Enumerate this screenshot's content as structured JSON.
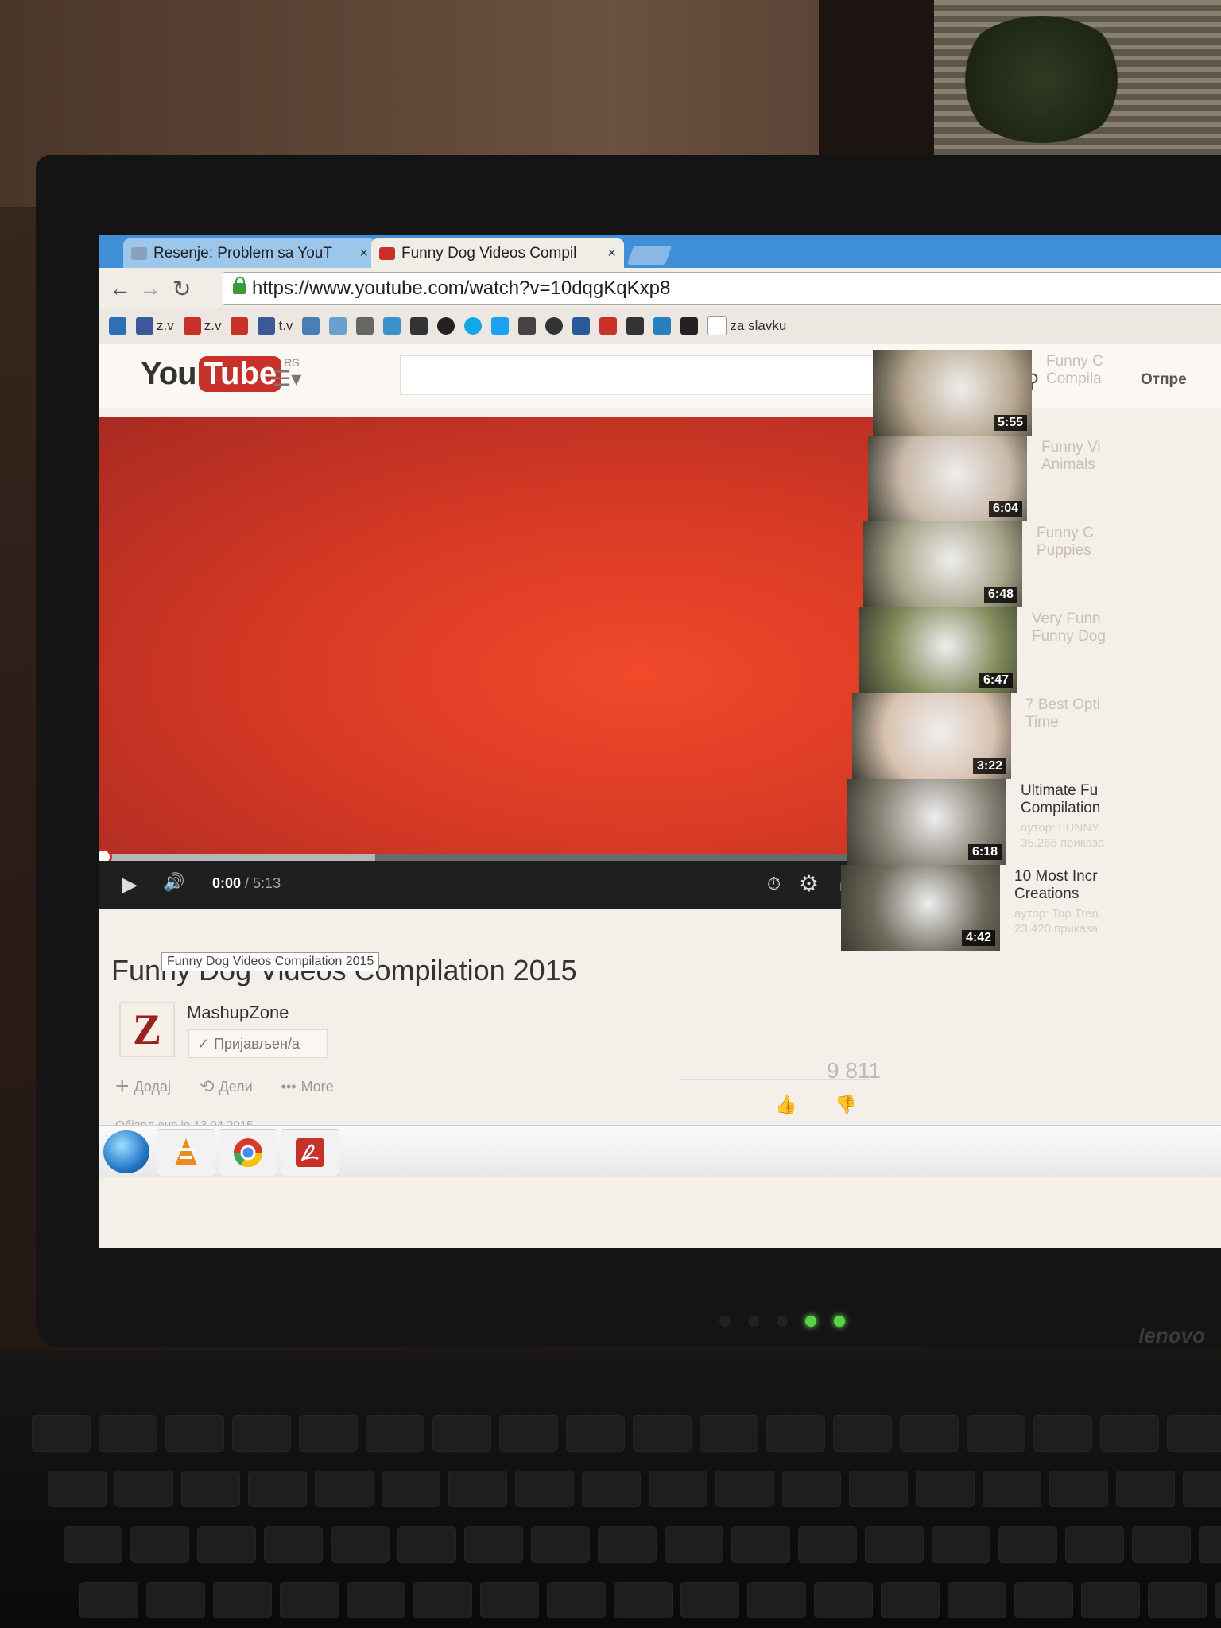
{
  "browser": {
    "tabs": [
      {
        "label": "Resenje: Problem sa YouT",
        "close": "×"
      },
      {
        "label": "Funny Dog Videos Compil",
        "close": "×"
      }
    ],
    "url": "https://www.youtube.com/watch?v=10dqgKqKxp8",
    "bookmarks": [
      {
        "label": "z.v",
        "color": "#3b5998"
      },
      {
        "label": "z.v",
        "color": "#c8302a"
      },
      {
        "label": "t.v",
        "color": "#3b5998"
      },
      {
        "label": "za slavku",
        "color": "#ffffff"
      }
    ]
  },
  "youtube": {
    "logo_you": "You",
    "logo_tube": "Tube",
    "logo_region": "RS",
    "upload_label": "Отпре"
  },
  "player": {
    "current_time": "0:00",
    "duration": "/ 5:13",
    "buffered_fraction": 0.33
  },
  "video": {
    "title": "Funny Dog Videos Compilation 2015",
    "tooltip": "Funny Dog Videos Compilation 2015",
    "channel_initial": "Z",
    "channel": "MashupZone",
    "subscribe_label": "Пријављен/а",
    "actions": {
      "add": "Додај",
      "share": "Дели",
      "more": "More"
    },
    "views": "9 811",
    "published": "Објављено је 13.04.2015."
  },
  "sidebar": [
    {
      "title": "Funny C Compila",
      "meta": "",
      "duration": "5:55",
      "faded": true,
      "color": "#b8a890"
    },
    {
      "title": "Funny Vi Animals",
      "meta": "",
      "duration": "6:04",
      "faded": true,
      "color": "#c9b8a8"
    },
    {
      "title": "Funny C Puppies",
      "meta": "",
      "duration": "6:48",
      "faded": true,
      "color": "#a7a48a"
    },
    {
      "title": "Very Funn Funny Dog",
      "meta": "",
      "duration": "6:47",
      "faded": true,
      "color": "#7f8a5a"
    },
    {
      "title": "7 Best Opti Time",
      "meta": "",
      "duration": "3:22",
      "faded": true,
      "color": "#d9c2b0"
    },
    {
      "title": "Ultimate Fu Compilation",
      "meta": "аутор: FUNNY 35.266 приказа",
      "duration": "6:18",
      "faded": false,
      "color": "#8a8478"
    },
    {
      "title": "10 Most Incr Creations",
      "meta": "аутор: Top Tren 23.420 приказа",
      "duration": "4:42",
      "faded": false,
      "color": "#6f6a5c"
    }
  ],
  "colors": {
    "accent": "#c8302a",
    "player_red": "#e4432a",
    "tabstrip": "#3f8fd8"
  }
}
